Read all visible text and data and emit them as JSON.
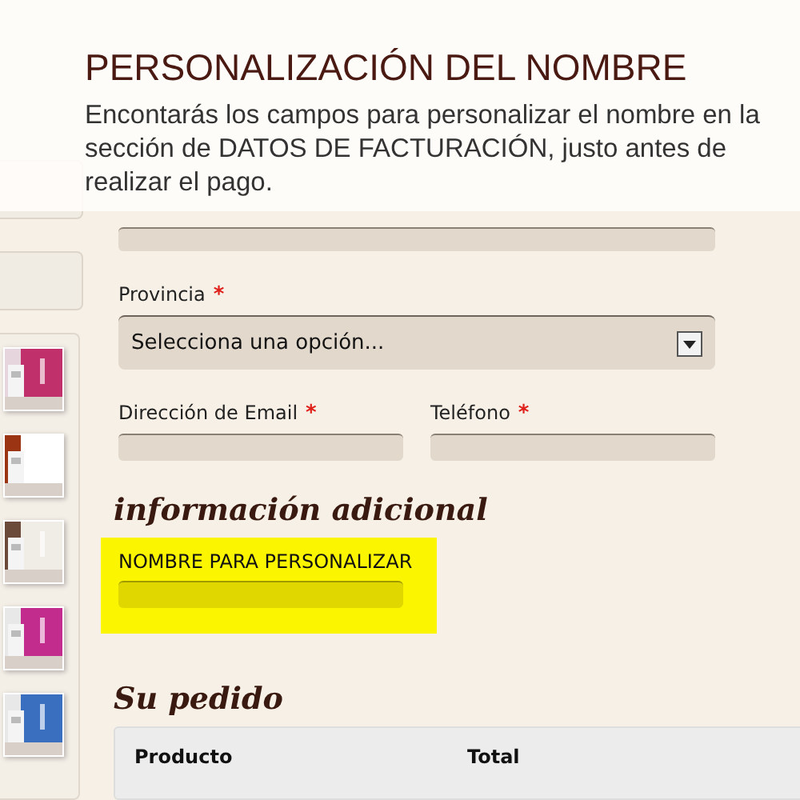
{
  "overlay": {
    "title": "PERSONALIZACIÓN DEL NOMBRE",
    "text": "Encontarás los campos para personalizar el nombre en la sección de DATOS DE FACTURACIÓN, justo antes de realizar el pago."
  },
  "billing": {
    "province": {
      "label": "Provincia",
      "required_mark": "*",
      "value": "Selecciona una opción..."
    },
    "fields": [
      {
        "label": "Dirección de Email",
        "required_mark": "*"
      },
      {
        "label": "Teléfono",
        "required_mark": "*"
      }
    ]
  },
  "additional": {
    "title": "información adicional",
    "highlighted": true,
    "field_label": "NOMBRE PARA PERSONALIZAR"
  },
  "order": {
    "title": "Su pedido",
    "columns": [
      "Producto",
      "Total"
    ]
  }
}
